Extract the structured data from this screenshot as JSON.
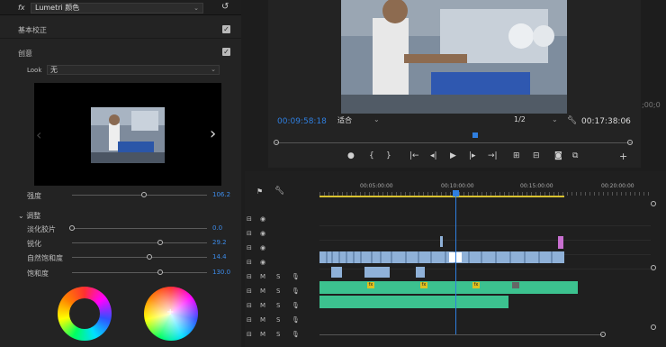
{
  "effect": {
    "fx_label": "fx",
    "title": "Lumetri 颜色",
    "reset_icon": "reset-icon"
  },
  "sections": {
    "basic": "基本校正",
    "creative": "创意",
    "look_label": "Look",
    "look_value": "无",
    "adjust": "调整"
  },
  "sliders": [
    {
      "label": "强度",
      "value": "106.2",
      "fraction": 0.53
    },
    {
      "label": "淡化胶片",
      "value": "0.0",
      "fraction": 0.0
    },
    {
      "label": "锐化",
      "value": "29.2",
      "fraction": 0.65
    },
    {
      "label": "自然饱和度",
      "value": "14.4",
      "fraction": 0.57
    },
    {
      "label": "饱和度",
      "value": "130.0",
      "fraction": 0.65
    }
  ],
  "monitor": {
    "timecode_current": "00:09:58:18",
    "fit_label": "适合",
    "resolution": "1/2",
    "timecode_duration": "00:17:38:06",
    "side_timecode": ";00;0",
    "playhead_fraction": 0.56
  },
  "ruler": {
    "ticks": [
      "00:05:00:00",
      "00:10:00:00",
      "00:15:00:00",
      "00:20:00:00"
    ]
  },
  "tracks": {
    "m_label": "M",
    "s_label": "S",
    "fx_badge": "fx"
  },
  "colors": {
    "accent": "#2f7fe0",
    "audio_clip": "#3cc28f",
    "video_clip": "#8fb1d8",
    "marker": "#c86fd0"
  }
}
